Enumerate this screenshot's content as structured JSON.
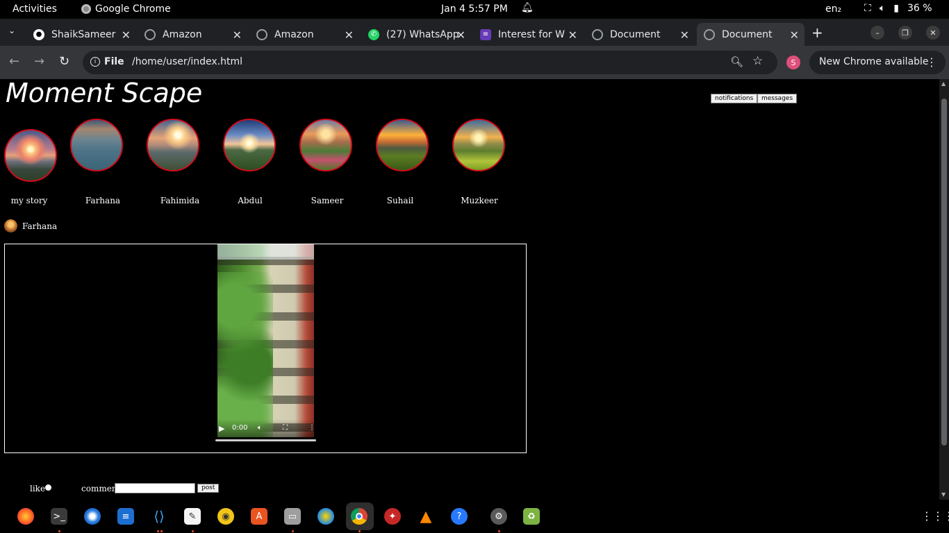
{
  "topbar": {
    "activities": "Activities",
    "app_name": "Google Chrome",
    "clock": "Jan 4   5:57 PM",
    "language": "en₂",
    "battery": "36 %"
  },
  "tabs": [
    {
      "title": "ShaikSameer",
      "icon": "github-icon"
    },
    {
      "title": "Amazon",
      "icon": "globe-icon"
    },
    {
      "title": "Amazon",
      "icon": "globe-icon"
    },
    {
      "title": "(27) WhatsApp",
      "icon": "whatsapp-icon"
    },
    {
      "title": "Interest for W",
      "icon": "form-icon"
    },
    {
      "title": "Document",
      "icon": "globe-icon"
    },
    {
      "title": "Document",
      "icon": "globe-icon"
    }
  ],
  "toolbar": {
    "site_info": "File",
    "url": "/home/user/index.html",
    "profile_initial": "S",
    "update_label": "New Chrome available"
  },
  "page": {
    "title": "Moment Scape",
    "notifications_label": "notifications",
    "messages_label": "messages",
    "stories": [
      {
        "name": "my story"
      },
      {
        "name": "Farhana"
      },
      {
        "name": "Fahimida"
      },
      {
        "name": "Abdul"
      },
      {
        "name": "Sameer"
      },
      {
        "name": "Suhail"
      },
      {
        "name": "Muzkeer"
      }
    ],
    "post": {
      "author": "Farhana",
      "video_time": "0:00",
      "like_label": "like",
      "comment_label": "comment",
      "comment_value": "",
      "post_label": "post"
    }
  },
  "dock": {
    "apps": [
      "firefox",
      "terminal",
      "thunderbird",
      "writer",
      "vscode",
      "text-editor",
      "rhythmbox",
      "app-center",
      "files",
      "remmina",
      "chrome",
      "inkscape",
      "vlc",
      "help",
      "settings",
      "trash"
    ]
  }
}
